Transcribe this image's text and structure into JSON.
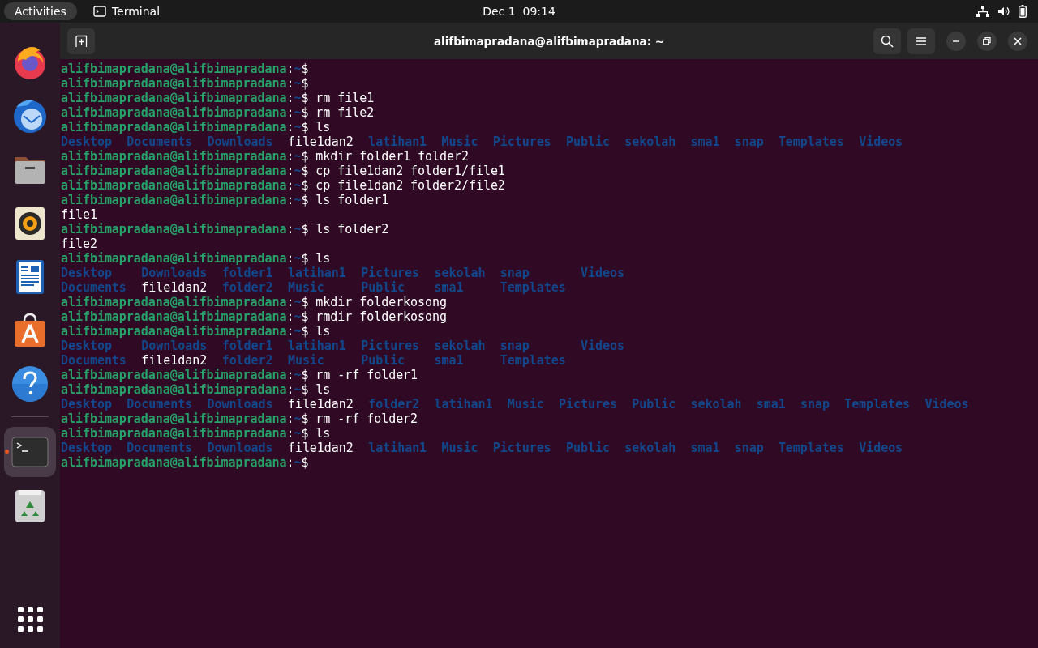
{
  "top_bar": {
    "activities": "Activities",
    "app_name": "Terminal",
    "clock": "Dec 1  09:14"
  },
  "dock": {
    "items": [
      {
        "kind": "browser",
        "selected": false,
        "running": false
      },
      {
        "kind": "mail",
        "selected": false,
        "running": false
      },
      {
        "kind": "folder",
        "selected": false,
        "running": false
      },
      {
        "kind": "speaker",
        "selected": false,
        "running": false
      },
      {
        "kind": "document",
        "selected": false,
        "running": false
      },
      {
        "kind": "store",
        "selected": false,
        "running": false
      },
      {
        "kind": "help",
        "selected": false,
        "running": false
      },
      {
        "kind": "separator"
      },
      {
        "kind": "terminal",
        "selected": true,
        "running": true
      },
      {
        "kind": "trash",
        "selected": false,
        "running": false
      }
    ]
  },
  "window": {
    "title": "alifbimapradana@alifbimapradana: ~"
  },
  "terminal": {
    "lines": [
      {
        "kind": "prompt",
        "user": "alifbimapradana@alifbimapradana",
        "separator": ":",
        "path": "~",
        "sigil": "$"
      },
      {
        "kind": "prompt",
        "user": "alifbimapradana@alifbimapradana",
        "separator": ":",
        "path": "~",
        "sigil": "$"
      },
      {
        "kind": "prompt",
        "user": "alifbimapradana@alifbimapradana",
        "separator": ":",
        "path": "~",
        "sigil": "$",
        "command": "rm file1"
      },
      {
        "kind": "prompt",
        "user": "alifbimapradana@alifbimapradana",
        "separator": ":",
        "path": "~",
        "sigil": "$",
        "command": "rm file2"
      },
      {
        "kind": "prompt",
        "user": "alifbimapradana@alifbimapradana",
        "separator": ":",
        "path": "~",
        "sigil": "$",
        "command": "ls"
      },
      {
        "kind": "listing",
        "rows": [
          [
            {
              "text": "Desktop",
              "kind": "dir"
            },
            {
              "text": "Documents",
              "kind": "dir"
            },
            {
              "text": "Downloads",
              "kind": "dir"
            },
            {
              "text": "file1dan2",
              "kind": "file"
            },
            {
              "text": "latihan1",
              "kind": "dir"
            },
            {
              "text": "Music",
              "kind": "dir"
            },
            {
              "text": "Pictures",
              "kind": "dir"
            },
            {
              "text": "Public",
              "kind": "dir"
            },
            {
              "text": "sekolah",
              "kind": "dir"
            },
            {
              "text": "sma1",
              "kind": "dir"
            },
            {
              "text": "snap",
              "kind": "dir"
            },
            {
              "text": "Templates",
              "kind": "dir"
            },
            {
              "text": "Videos",
              "kind": "dir"
            }
          ]
        ]
      },
      {
        "kind": "prompt",
        "user": "alifbimapradana@alifbimapradana",
        "separator": ":",
        "path": "~",
        "sigil": "$",
        "command": "mkdir folder1 folder2"
      },
      {
        "kind": "prompt",
        "user": "alifbimapradana@alifbimapradana",
        "separator": ":",
        "path": "~",
        "sigil": "$",
        "command": "cp file1dan2 folder1/file1"
      },
      {
        "kind": "prompt",
        "user": "alifbimapradana@alifbimapradana",
        "separator": ":",
        "path": "~",
        "sigil": "$",
        "command": "cp file1dan2 folder2/file2"
      },
      {
        "kind": "prompt",
        "user": "alifbimapradana@alifbimapradana",
        "separator": ":",
        "path": "~",
        "sigil": "$",
        "command": "ls folder1"
      },
      {
        "kind": "output",
        "text": "file1"
      },
      {
        "kind": "prompt",
        "user": "alifbimapradana@alifbimapradana",
        "separator": ":",
        "path": "~",
        "sigil": "$",
        "command": "ls folder2"
      },
      {
        "kind": "output",
        "text": "file2"
      },
      {
        "kind": "prompt",
        "user": "alifbimapradana@alifbimapradana",
        "separator": ":",
        "path": "~",
        "sigil": "$",
        "command": "ls"
      },
      {
        "kind": "listing",
        "rows": [
          [
            {
              "text": "Desktop",
              "kind": "dir"
            },
            {
              "text": "Downloads",
              "kind": "dir"
            },
            {
              "text": "folder1",
              "kind": "dir"
            },
            {
              "text": "latihan1",
              "kind": "dir"
            },
            {
              "text": "Pictures",
              "kind": "dir"
            },
            {
              "text": "sekolah",
              "kind": "dir"
            },
            {
              "text": "snap",
              "kind": "dir"
            },
            {
              "text": "Videos",
              "kind": "dir"
            }
          ],
          [
            {
              "text": "Documents",
              "kind": "dir"
            },
            {
              "text": "file1dan2",
              "kind": "file"
            },
            {
              "text": "folder2",
              "kind": "dir"
            },
            {
              "text": "Music",
              "kind": "dir"
            },
            {
              "text": "Public",
              "kind": "dir"
            },
            {
              "text": "sma1",
              "kind": "dir"
            },
            {
              "text": "Templates",
              "kind": "dir"
            }
          ]
        ]
      },
      {
        "kind": "prompt",
        "user": "alifbimapradana@alifbimapradana",
        "separator": ":",
        "path": "~",
        "sigil": "$",
        "command": "mkdir folderkosong"
      },
      {
        "kind": "prompt",
        "user": "alifbimapradana@alifbimapradana",
        "separator": ":",
        "path": "~",
        "sigil": "$",
        "command": "rmdir folderkosong"
      },
      {
        "kind": "prompt",
        "user": "alifbimapradana@alifbimapradana",
        "separator": ":",
        "path": "~",
        "sigil": "$",
        "command": "ls"
      },
      {
        "kind": "listing",
        "rows": [
          [
            {
              "text": "Desktop",
              "kind": "dir"
            },
            {
              "text": "Downloads",
              "kind": "dir"
            },
            {
              "text": "folder1",
              "kind": "dir"
            },
            {
              "text": "latihan1",
              "kind": "dir"
            },
            {
              "text": "Pictures",
              "kind": "dir"
            },
            {
              "text": "sekolah",
              "kind": "dir"
            },
            {
              "text": "snap",
              "kind": "dir"
            },
            {
              "text": "Videos",
              "kind": "dir"
            }
          ],
          [
            {
              "text": "Documents",
              "kind": "dir"
            },
            {
              "text": "file1dan2",
              "kind": "file"
            },
            {
              "text": "folder2",
              "kind": "dir"
            },
            {
              "text": "Music",
              "kind": "dir"
            },
            {
              "text": "Public",
              "kind": "dir"
            },
            {
              "text": "sma1",
              "kind": "dir"
            },
            {
              "text": "Templates",
              "kind": "dir"
            }
          ]
        ]
      },
      {
        "kind": "prompt",
        "user": "alifbimapradana@alifbimapradana",
        "separator": ":",
        "path": "~",
        "sigil": "$",
        "command": "rm -rf folder1"
      },
      {
        "kind": "prompt",
        "user": "alifbimapradana@alifbimapradana",
        "separator": ":",
        "path": "~",
        "sigil": "$",
        "command": "ls"
      },
      {
        "kind": "listing",
        "rows": [
          [
            {
              "text": "Desktop",
              "kind": "dir"
            },
            {
              "text": "Documents",
              "kind": "dir"
            },
            {
              "text": "Downloads",
              "kind": "dir"
            },
            {
              "text": "file1dan2",
              "kind": "file"
            },
            {
              "text": "folder2",
              "kind": "dir"
            },
            {
              "text": "latihan1",
              "kind": "dir"
            },
            {
              "text": "Music",
              "kind": "dir"
            },
            {
              "text": "Pictures",
              "kind": "dir"
            },
            {
              "text": "Public",
              "kind": "dir"
            },
            {
              "text": "sekolah",
              "kind": "dir"
            },
            {
              "text": "sma1",
              "kind": "dir"
            },
            {
              "text": "snap",
              "kind": "dir"
            },
            {
              "text": "Templates",
              "kind": "dir"
            },
            {
              "text": "Videos",
              "kind": "dir"
            }
          ]
        ]
      },
      {
        "kind": "prompt",
        "user": "alifbimapradana@alifbimapradana",
        "separator": ":",
        "path": "~",
        "sigil": "$",
        "command": "rm -rf folder2"
      },
      {
        "kind": "prompt",
        "user": "alifbimapradana@alifbimapradana",
        "separator": ":",
        "path": "~",
        "sigil": "$",
        "command": "ls"
      },
      {
        "kind": "listing",
        "rows": [
          [
            {
              "text": "Desktop",
              "kind": "dir"
            },
            {
              "text": "Documents",
              "kind": "dir"
            },
            {
              "text": "Downloads",
              "kind": "dir"
            },
            {
              "text": "file1dan2",
              "kind": "file"
            },
            {
              "text": "latihan1",
              "kind": "dir"
            },
            {
              "text": "Music",
              "kind": "dir"
            },
            {
              "text": "Pictures",
              "kind": "dir"
            },
            {
              "text": "Public",
              "kind": "dir"
            },
            {
              "text": "sekolah",
              "kind": "dir"
            },
            {
              "text": "sma1",
              "kind": "dir"
            },
            {
              "text": "snap",
              "kind": "dir"
            },
            {
              "text": "Templates",
              "kind": "dir"
            },
            {
              "text": "Videos",
              "kind": "dir"
            }
          ]
        ]
      },
      {
        "kind": "prompt",
        "user": "alifbimapradana@alifbimapradana",
        "separator": ":",
        "path": "~",
        "sigil": "$"
      }
    ]
  }
}
